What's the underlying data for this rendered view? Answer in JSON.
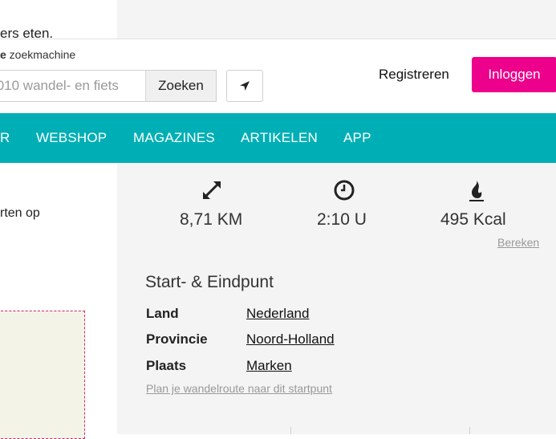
{
  "top_fragment": "ers eten.",
  "search": {
    "caption_bold": "e",
    "caption_rest": " zoekmachine",
    "placeholder": ".010 wandel- en fiets",
    "button_label": "Zoeken",
    "location_icon": "location-arrow-icon"
  },
  "header": {
    "register_label": "Registreren",
    "login_label": "Inloggen",
    "login_color": "#ec008c"
  },
  "nav": {
    "color": "#00afb5",
    "items": [
      {
        "label": "R"
      },
      {
        "label": "WEBSHOP"
      },
      {
        "label": "MAGAZINES"
      },
      {
        "label": "ARTIKELEN"
      },
      {
        "label": "APP"
      }
    ]
  },
  "left": {
    "mid_fragment": "rten op"
  },
  "stats": {
    "distance": {
      "icon": "expand-arrows-icon",
      "value": "8,71 KM"
    },
    "duration": {
      "icon": "clock-icon",
      "value": "2:10 U"
    },
    "calories": {
      "icon": "flame-icon",
      "value": "495 Kcal"
    },
    "calculate_label": "Bereken"
  },
  "start": {
    "title": "Start- & Eindpunt",
    "rows": [
      {
        "label": "Land",
        "value": "Nederland"
      },
      {
        "label": "Provincie",
        "value": "Noord-Holland"
      },
      {
        "label": "Plaats",
        "value": "Marken"
      }
    ],
    "plan_link": "Plan je wandelroute naar dit startpunt"
  }
}
